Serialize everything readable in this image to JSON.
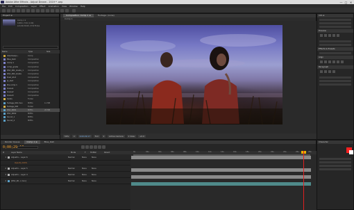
{
  "window": {
    "title": "Adobe After Effects - Adjust Dream - 2019 * .aep",
    "controls": [
      "—",
      "□",
      "✕"
    ]
  },
  "menu": [
    "File",
    "Edit",
    "Composition",
    "Layer",
    "Effect",
    "Animation",
    "View",
    "Window",
    "Help"
  ],
  "project": {
    "tab": "Project ≡",
    "meta": [
      "Comp 1 ▾",
      "1280 x 720 (1.00)",
      "Δ 0;00;30;00, 23.976 fps"
    ],
    "columns": [
      "Name",
      "Type",
      "Size"
    ],
    "items": [
      {
        "name": "dreamsequ...",
        "type": "Comp",
        "size": "",
        "color": "#c9a33a"
      },
      {
        "name": "Blue_bleh",
        "type": "Composition",
        "size": "",
        "color": "#7c80c8"
      },
      {
        "name": "Comp 1",
        "type": "Composition",
        "size": "",
        "color": "#7c80c8"
      },
      {
        "name": "comp_grade",
        "type": "Composition",
        "size": "",
        "color": "#7c80c8"
      },
      {
        "name": "DSC_001_Grade_1",
        "type": "Composition",
        "size": "",
        "color": "#7c80c8"
      },
      {
        "name": "DSC_002_Grade",
        "type": "Composition",
        "size": "",
        "color": "#7c80c8"
      },
      {
        "name": "Dual_shot",
        "type": "Composition",
        "size": "",
        "color": "#7c80c8"
      },
      {
        "name": "Jk_shot",
        "type": "Composition",
        "size": "",
        "color": "#7c80c8"
      },
      {
        "name": "Pre-comp 1",
        "type": "Composition",
        "size": "",
        "color": "#7c80c8"
      },
      {
        "name": "Scene1",
        "type": "Composition",
        "size": "",
        "color": "#7c80c8"
      },
      {
        "name": "Scene2",
        "type": "Composition",
        "size": "",
        "color": "#7c80c8"
      },
      {
        "name": "Scene3",
        "type": "Composition",
        "size": "",
        "color": "#7c80c8"
      },
      {
        "name": "Solids",
        "type": "Folder",
        "size": "",
        "color": "#d4b34a"
      },
      {
        "name": "footage_001.mov",
        "type": "MPEG",
        "size": "11 MB",
        "color": "#5aa0c8"
      },
      {
        "name": "footage_002",
        "type": "Folder",
        "size": "",
        "color": "#d4b34a"
      },
      {
        "name": "DSC_0001",
        "type": "MPEG",
        "size": "20 MB",
        "color": "#5aa0c8"
      },
      {
        "name": "DSC_0002",
        "type": "MPEG",
        "size": "",
        "color": "#5aa0c8"
      },
      {
        "name": "Sound_1",
        "type": "MPEG",
        "size": "",
        "color": "#5aa0c8"
      },
      {
        "name": "Sound_2",
        "type": "MPEG",
        "size": "",
        "color": "#5aa0c8"
      }
    ],
    "selected_index": 15
  },
  "composition": {
    "tabs": [
      "Composition: Comp 1 ≡",
      "Footage: (none)"
    ],
    "sub": "Comp 1",
    "footer": [
      "50%",
      "▾",
      "0;00;29;17",
      "Full",
      "▾",
      "Active Camera",
      "1 View",
      "+0.0"
    ]
  },
  "right_panel": {
    "info_tab": "Info ≡",
    "tabs": [
      "Preview",
      "Effects & Presets",
      "Align",
      "Paragraph",
      "Character"
    ]
  },
  "timeline": {
    "tabs": [
      "Render Queue",
      "Comp 1 ≡",
      "Blue_bleh"
    ],
    "timecode": "0;00;29;17",
    "columns": [
      "#",
      "Layer Name",
      "Mode",
      "T",
      "TrkMat",
      "Parent"
    ],
    "layers": [
      {
        "num": "1",
        "name": "Adjustm... Layer 6",
        "mode": "Normal",
        "trk": "None",
        "parent": "None",
        "color": "#b0b0b0",
        "sub": ""
      },
      {
        "num": "",
        "name": "",
        "mode": "",
        "trk": "",
        "parent": "",
        "color": "",
        "sub": "Opacity    100%"
      },
      {
        "num": "2",
        "name": "Adjustm... Layer 5",
        "mode": "Normal",
        "trk": "None",
        "parent": "None",
        "color": "#b0b0b0",
        "sub": ""
      },
      {
        "num": "3",
        "name": "Adjustm... Layer 4",
        "mode": "Normal",
        "trk": "None",
        "parent": "None",
        "color": "#b0b0b0",
        "sub": ""
      },
      {
        "num": "4",
        "name": "[DSC_00...l.mov]",
        "mode": "Normal",
        "trk": "None",
        "parent": "None",
        "color": "#5aa0c8",
        "sub": ""
      }
    ],
    "ruler": [
      "0s",
      "02s",
      "04s",
      "06s",
      "08s",
      "10s",
      "12s",
      "14s",
      "16s",
      "18s",
      "20s",
      "22s",
      "24s",
      "26s",
      "28s"
    ],
    "track_colors": [
      "#8a8a8a",
      "",
      "#8a8a8a",
      "#8a8a8a",
      "#4f8a8a"
    ]
  },
  "colors": {
    "playhead": "#e02020",
    "timecode": "#f0a030",
    "swatch_fg": "#ff2020",
    "swatch_bg": "#ffffff"
  }
}
